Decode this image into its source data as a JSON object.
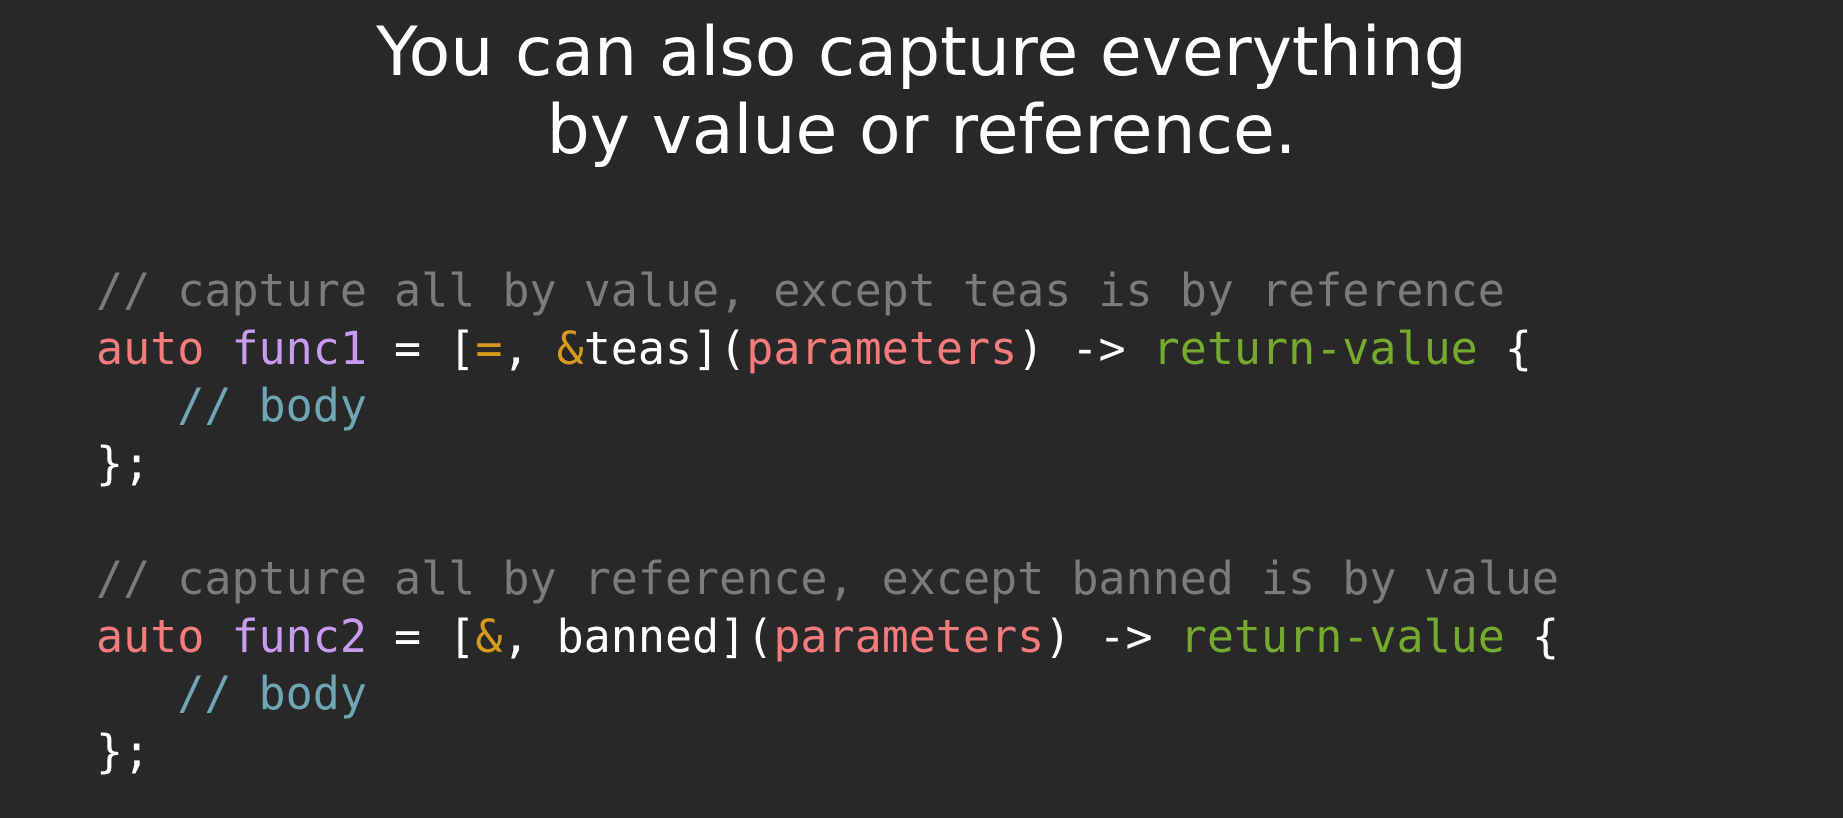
{
  "title": {
    "line1": "You can also capture everything",
    "line2": "by value or reference."
  },
  "code": {
    "block1": {
      "comment": "// capture all by value, except teas is by reference",
      "kw": "auto",
      "name": "func1",
      "eq": " = [",
      "capture_default": "=",
      "sep": ", ",
      "capture_ref_op": "&",
      "capture_var": "teas",
      "close": "](",
      "params": "parameters",
      "arrow": ") -> ",
      "ret": "return-value",
      "brace": " {",
      "body": "// body",
      "end": "};"
    },
    "block2": {
      "comment": "// capture all by reference, except banned is by value",
      "kw": "auto",
      "name": "func2",
      "eq": " = [",
      "capture_default": "&",
      "sep": ", ",
      "capture_var": "banned",
      "close": "](",
      "params": "parameters",
      "arrow": ") -> ",
      "ret": "return-value",
      "brace": " {",
      "body": "// body",
      "end": "};"
    }
  },
  "colors": {
    "background": "#282828",
    "comment": "#7b7b7b",
    "keyword": "#f47b7b",
    "function": "#c99bf0",
    "operator": "#d89a1d",
    "return": "#76aa2e",
    "body_comment": "#6ea6b6",
    "text": "#ffffff"
  }
}
